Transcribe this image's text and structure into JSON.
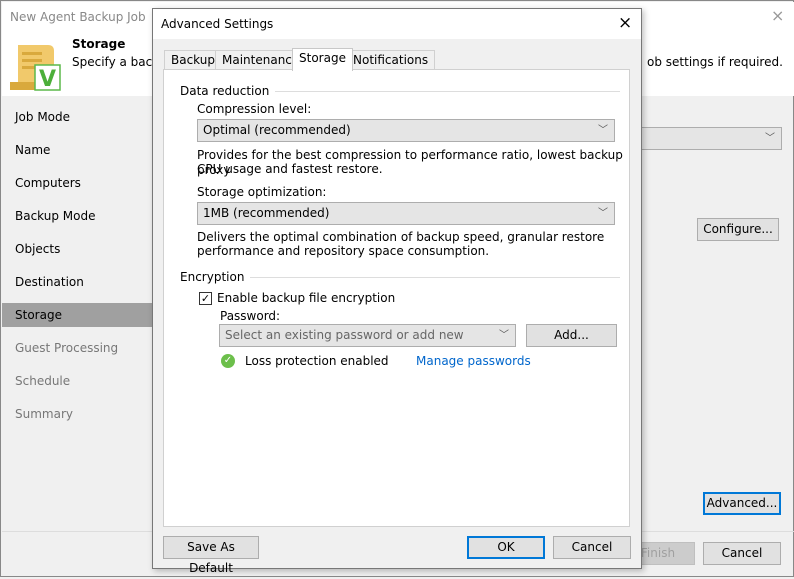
{
  "window": {
    "title": "New Agent Backup Job",
    "close": "×"
  },
  "header": {
    "title": "Storage",
    "description_left": "Specify a backu",
    "description_right": "ob settings if required."
  },
  "nav": {
    "items": [
      {
        "label": "Job Mode"
      },
      {
        "label": "Name"
      },
      {
        "label": "Computers"
      },
      {
        "label": "Backup Mode"
      },
      {
        "label": "Objects"
      },
      {
        "label": "Destination"
      },
      {
        "label": "Storage"
      },
      {
        "label": "Guest Processing"
      },
      {
        "label": "Schedule"
      },
      {
        "label": "Summary"
      }
    ]
  },
  "wizard": {
    "configure": "Configure...",
    "advanced": "Advanced...",
    "finish": "Finish",
    "cancel": "Cancel"
  },
  "dialog": {
    "title": "Advanced Settings",
    "close": "×",
    "tabs": [
      "Backup",
      "Maintenance",
      "Storage",
      "Notifications"
    ],
    "data_reduction": "Data reduction",
    "compression_label": "Compression level:",
    "compression_value": "Optimal (recommended)",
    "compression_desc1": "Provides for the best compression to performance ratio, lowest backup proxy",
    "compression_desc2": "CPU usage and fastest restore.",
    "optimization_label": "Storage optimization:",
    "optimization_value": "1MB (recommended)",
    "optimization_desc1": "Delivers the optimal combination of backup speed, granular restore",
    "optimization_desc2": "performance and repository space consumption.",
    "encryption": "Encryption",
    "enable_encryption": "Enable backup file encryption",
    "enable_encryption_checked": true,
    "password_label": "Password:",
    "password_placeholder": "Select an existing password or add new",
    "add": "Add...",
    "loss_protection": "Loss protection enabled",
    "manage_passwords": "Manage passwords",
    "save_default": "Save As Default",
    "ok": "OK",
    "cancel": "Cancel"
  }
}
